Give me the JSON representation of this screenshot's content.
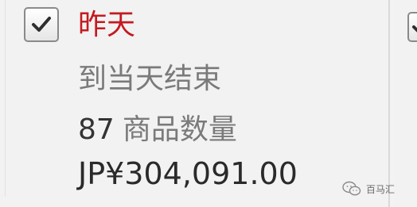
{
  "card": {
    "checked": true,
    "period": "昨天",
    "period_desc": "到当天结束",
    "count_number": "87",
    "count_label": "商品数量",
    "amount": "JP¥304,091.00"
  },
  "next_card": {
    "checked": true
  },
  "watermark": {
    "text": "百马汇",
    "icon": "wechat-icon"
  },
  "colors": {
    "period_red": "#c41a20",
    "secondary_gray": "#7a7a7a",
    "dark_text": "#2a2a2a",
    "background": "#f2f2f2"
  }
}
